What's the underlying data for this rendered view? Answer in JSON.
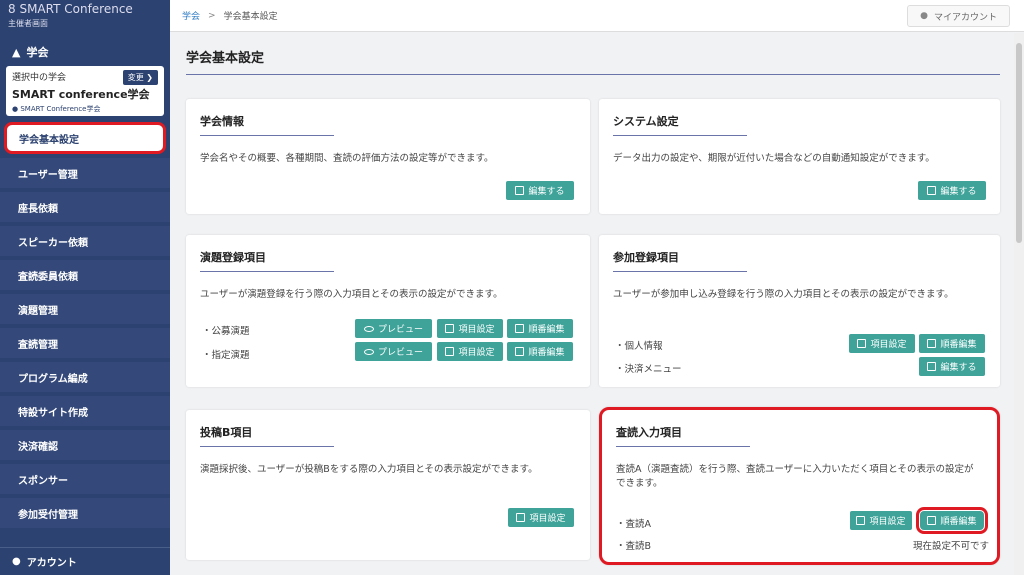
{
  "brand": {
    "logo": "SMART Conference",
    "sub": "主催者画面"
  },
  "sidebar": {
    "section": "学会",
    "association": {
      "selected_label": "選択中の学会",
      "change_label": "変更 ❯",
      "name": "SMART conference学会",
      "sub": "SMART Conference学会"
    },
    "items": [
      {
        "label": "学会基本設定"
      },
      {
        "label": "ユーザー管理"
      },
      {
        "label": "座長依頼"
      },
      {
        "label": "スピーカー依頼"
      },
      {
        "label": "査読委員依頼"
      },
      {
        "label": "演題管理"
      },
      {
        "label": "査読管理"
      },
      {
        "label": "プログラム編成"
      },
      {
        "label": "特設サイト作成"
      },
      {
        "label": "決済確認"
      },
      {
        "label": "スポンサー"
      },
      {
        "label": "参加受付管理"
      }
    ],
    "account": "アカウント"
  },
  "topbar": {
    "crumb_root": "学会",
    "crumb_sep": ">",
    "crumb_current": "学会基本設定",
    "account_button": "マイアカウント"
  },
  "page": {
    "title": "学会基本設定"
  },
  "cards": {
    "gakkai": {
      "title": "学会情報",
      "desc": "学会名やその概要、各種期間、査読の評価方法の設定等ができます。",
      "edit": "編集する"
    },
    "system": {
      "title": "システム設定",
      "desc": "データ出力の設定や、期限が近付いた場合などの自動通知設定ができます。",
      "edit": "編集する"
    },
    "endai": {
      "title": "演題登録項目",
      "desc": "ユーザーが演題登録を行う際の入力項目とその表示の設定ができます。",
      "rows": [
        {
          "label": "・公募演題"
        },
        {
          "label": "・指定演題"
        }
      ],
      "preview": "プレビュー",
      "item_setting": "項目設定",
      "order_edit": "順番編集"
    },
    "sanka": {
      "title": "参加登録項目",
      "desc": "ユーザーが参加申し込み登録を行う際の入力項目とその表示の設定ができます。",
      "rows": [
        {
          "label": "・個人情報"
        },
        {
          "label": "・決済メニュー"
        }
      ],
      "item_setting": "項目設定",
      "order_edit": "順番編集",
      "edit": "編集する"
    },
    "toko": {
      "title": "投稿B項目",
      "desc": "演題採択後、ユーザーが投稿Bをする際の入力項目とその表示設定ができます。",
      "item_setting": "項目設定"
    },
    "sadoku": {
      "title": "査読入力項目",
      "desc": "査読A（演題査読）を行う際、査読ユーザーに入力いただく項目とその表示の設定ができます。",
      "rows": [
        {
          "label": "・査読A"
        },
        {
          "label": "・査読B"
        }
      ],
      "item_setting": "項目設定",
      "order_edit": "順番編集",
      "note": "現在設定不可です"
    }
  }
}
